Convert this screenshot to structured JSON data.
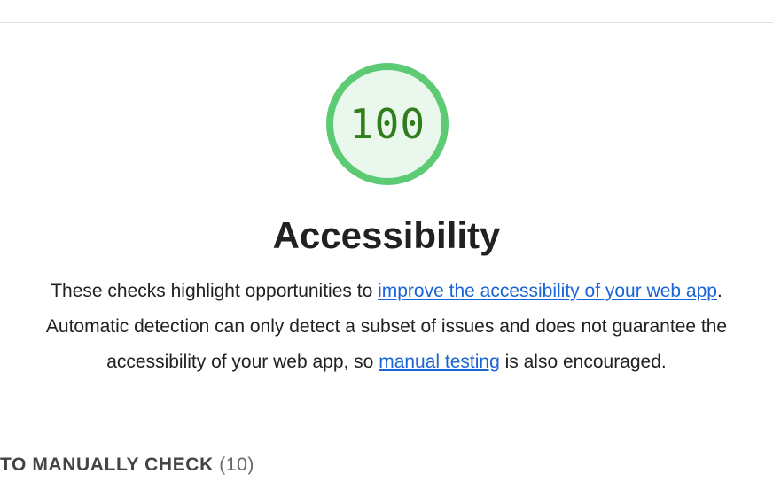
{
  "category": {
    "score": "100",
    "score_value": 100,
    "title": "Accessibility",
    "colors": {
      "ring": "#5ccb74",
      "fill": "#eaf7ec",
      "score_text": "#2f7d1b",
      "link": "#1a64d6"
    }
  },
  "description": {
    "part1": "These checks highlight opportunities to ",
    "link1": "improve the accessibility of your web app",
    "part2": ". Automatic detection can only detect a subset of issues and does not guarantee the accessibility of your web app, so ",
    "link2": "manual testing",
    "part3": " is also encouraged."
  },
  "manual_group": {
    "title": "TO MANUALLY CHECK",
    "count": "(10)"
  }
}
